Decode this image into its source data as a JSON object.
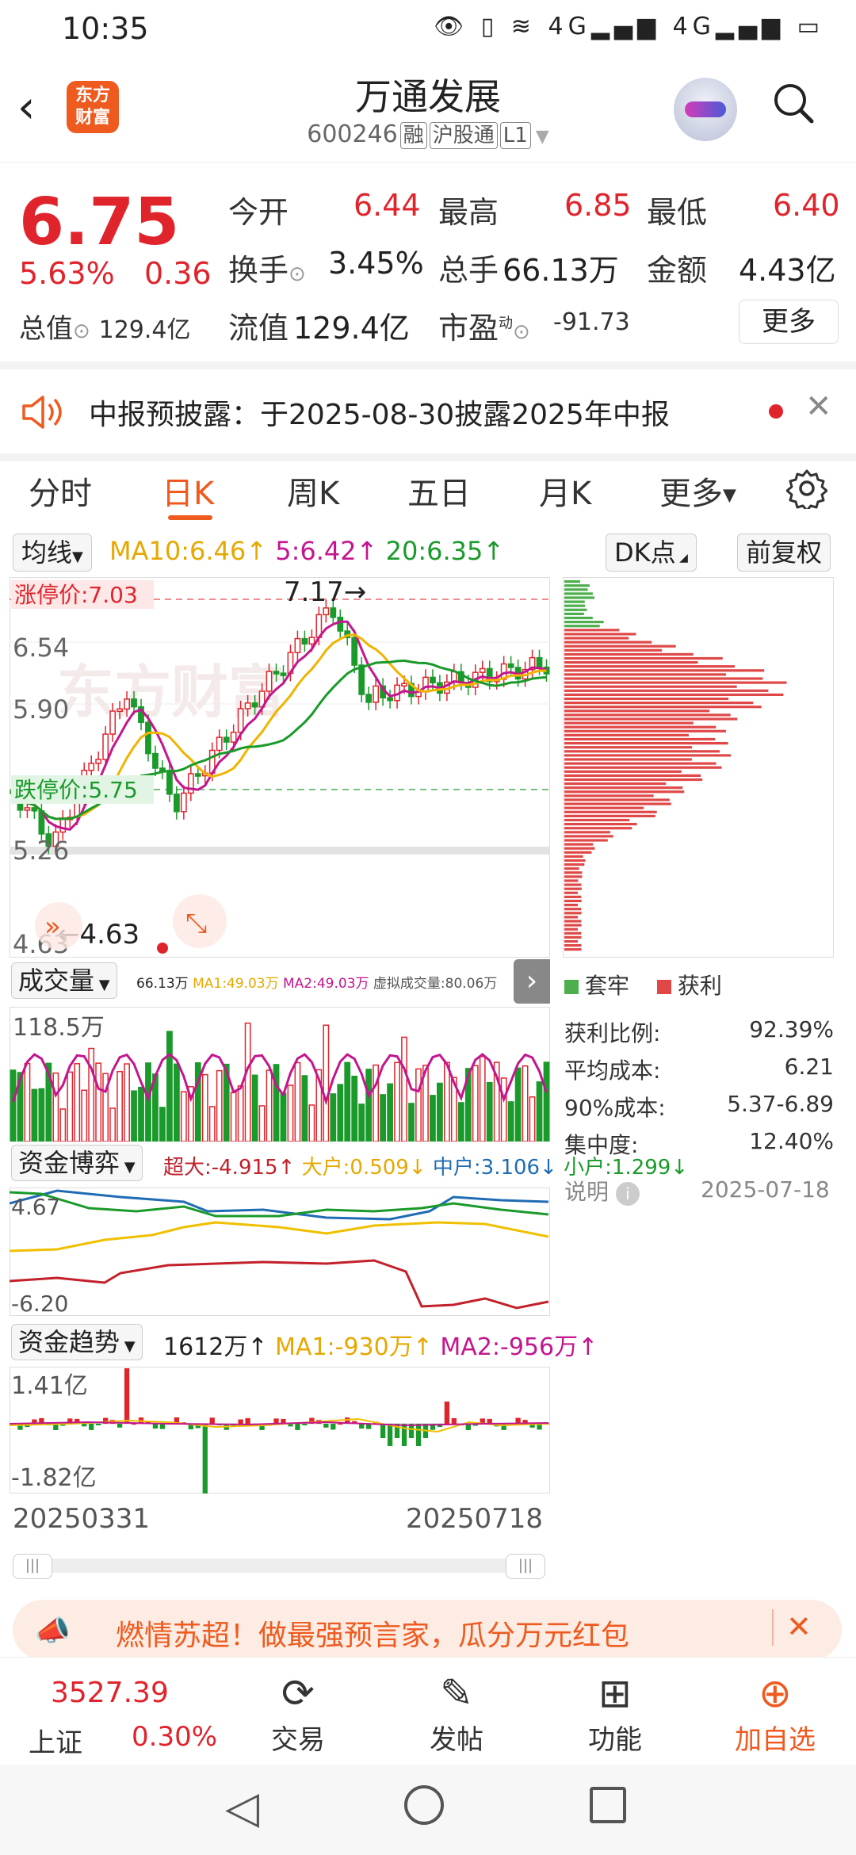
{
  "status_bar": {
    "time": "10:35",
    "icons": "👁 ▯ ≋ 4G▂▄▆ 4G▂▄▆ ▭"
  },
  "header": {
    "logo_text_1": "东方",
    "logo_text_2": "财富",
    "stock_name": "万通发展",
    "stock_code": "600246",
    "badges": [
      "融",
      "沪股通",
      "L1"
    ]
  },
  "quote": {
    "price": "6.75",
    "change_pct": "5.63%",
    "change_amt": "0.36",
    "open_label": "今开",
    "open": "6.44",
    "high_label": "最高",
    "high": "6.85",
    "low_label": "最低",
    "low": "6.40",
    "turnover_label": "换手",
    "turnover": "3.45%",
    "volume_label": "总手",
    "volume": "66.13万",
    "amount_label": "金额",
    "amount": "4.43亿",
    "mktcap_label": "总值",
    "mktcap": "129.4亿",
    "float_label": "流值",
    "float": "129.4亿",
    "pe_label": "市盈",
    "pe_sup": "动",
    "pe": "-91.73",
    "more_button": "更多"
  },
  "notice": {
    "text": "中报预披露：于2025-08-30披露2025年中报"
  },
  "tabs": [
    "分时",
    "日K",
    "周K",
    "五日",
    "月K",
    "更多"
  ],
  "chart_header": {
    "ma_button": "均线",
    "ma10": "MA10:6.46↑",
    "ma5": "5:6.42↑",
    "ma20": "20:6.35↑",
    "dk_button": "DK点",
    "adjust_button": "前复权"
  },
  "kline": {
    "limit_up": "涨停价:7.03",
    "limit_down": "跌停价:5.75",
    "high_marker": "7.17→",
    "low_marker": "←4.63",
    "axis_labels": [
      "6.54",
      "5.90",
      "5.26",
      "4.63"
    ]
  },
  "volume_panel": {
    "button": "成交量",
    "info": "66.13万",
    "ma1": "MA1:49.03万",
    "ma2": "MA2:49.03万",
    "virtual": "虚拟成交量:80.06万",
    "axis_top": "118.5万"
  },
  "fund_game": {
    "button": "资金博弈",
    "super_large": "超大:-4.915↑",
    "large": "大户:0.509↓",
    "medium": "中户:3.106↓",
    "small": "小户:1.299↓",
    "axis_top": "4.67",
    "axis_bottom": "-6.20"
  },
  "fund_trend": {
    "button": "资金趋势",
    "value": "1612万↑",
    "ma1": "MA1:-930万↑",
    "ma2": "MA2:-956万↑",
    "axis_top": "1.41亿",
    "axis_bottom": "-1.82亿"
  },
  "date_range": {
    "start": "20250331",
    "end": "20250718"
  },
  "chip_panel": {
    "legend_trapped": "套牢",
    "legend_profit": "获利",
    "stats": [
      {
        "label": "获利比例:",
        "value": "92.39%"
      },
      {
        "label": "平均成本:",
        "value": "6.21"
      },
      {
        "label": "90%成本:",
        "value": "5.37-6.89"
      },
      {
        "label": "集中度:",
        "value": "12.40%"
      }
    ],
    "help_label": "说明",
    "date": "2025-07-18"
  },
  "banner": {
    "text": "燃情苏超！做最强预言家，瓜分万元红包"
  },
  "bottom_nav": {
    "index_value": "3527.39",
    "index_name": "上证",
    "index_change": "0.30%",
    "items": [
      "交易",
      "发帖",
      "功能",
      "加自选"
    ]
  },
  "colors": {
    "accent": "#ef5a1f",
    "up": "#e0242c",
    "down": "#1a9a2a"
  }
}
